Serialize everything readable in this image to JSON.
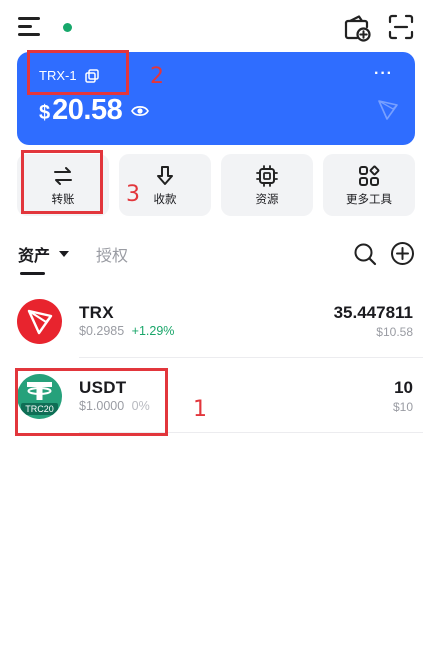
{
  "header": {
    "status_dot_color": "#17a86b",
    "icons": [
      "menu-icon",
      "add-wallet-icon",
      "scan-icon"
    ]
  },
  "wallet_card": {
    "name": "TRX-1",
    "currency_symbol": "$",
    "balance": "20.58",
    "more": "···",
    "color": "#2f6dff"
  },
  "actions": [
    {
      "label": "转账",
      "icon": "transfer-icon"
    },
    {
      "label": "收款",
      "icon": "receive-icon"
    },
    {
      "label": "资源",
      "icon": "resource-chip-icon"
    },
    {
      "label": "更多工具",
      "icon": "more-tools-icon"
    }
  ],
  "tabs": {
    "assets": "资产",
    "authorization": "授权"
  },
  "tokens": [
    {
      "symbol": "TRX",
      "price": "$0.2985",
      "change": "+1.29%",
      "change_color": "#1aa66a",
      "amount": "35.447811",
      "value": "$10.58",
      "logo_color": "#e8242e"
    },
    {
      "symbol": "USDT",
      "price": "$1.0000",
      "change": "0%",
      "change_color": "#b8bac0",
      "amount": "10",
      "value": "$10",
      "badge": "TRC20",
      "logo_color": "#26a17b"
    }
  ],
  "annotations": [
    {
      "label": "1"
    },
    {
      "label": "2"
    },
    {
      "label": "3"
    }
  ]
}
